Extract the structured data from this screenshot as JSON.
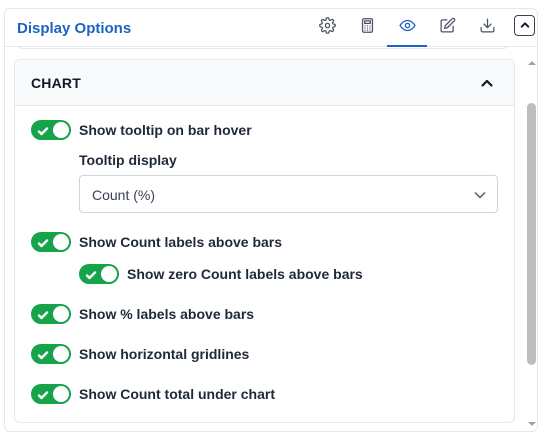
{
  "header": {
    "title": "Display Options",
    "tools": [
      {
        "icon": "gear-icon"
      },
      {
        "icon": "calculator-icon"
      },
      {
        "icon": "eye-icon",
        "active": true
      },
      {
        "icon": "edit-icon"
      },
      {
        "icon": "download-icon"
      }
    ],
    "collapse_icon": "chevron-up-icon"
  },
  "section": {
    "title": "CHART",
    "expanded": true
  },
  "options": {
    "tooltip_on_hover": {
      "label": "Show tooltip on bar hover",
      "on": true
    },
    "tooltip_display": {
      "label": "Tooltip display",
      "value": "Count (%)"
    },
    "count_labels": {
      "label": "Show Count labels above bars",
      "on": true
    },
    "zero_count_labels": {
      "label": "Show zero Count labels above bars",
      "on": true
    },
    "percent_labels": {
      "label": "Show % labels above bars",
      "on": true
    },
    "horizontal_gridlines": {
      "label": "Show horizontal gridlines",
      "on": true
    },
    "count_total": {
      "label": "Show Count total under chart",
      "on": true
    }
  },
  "colors": {
    "accent": "#1d63c4",
    "toggle_on": "#16a34a"
  }
}
